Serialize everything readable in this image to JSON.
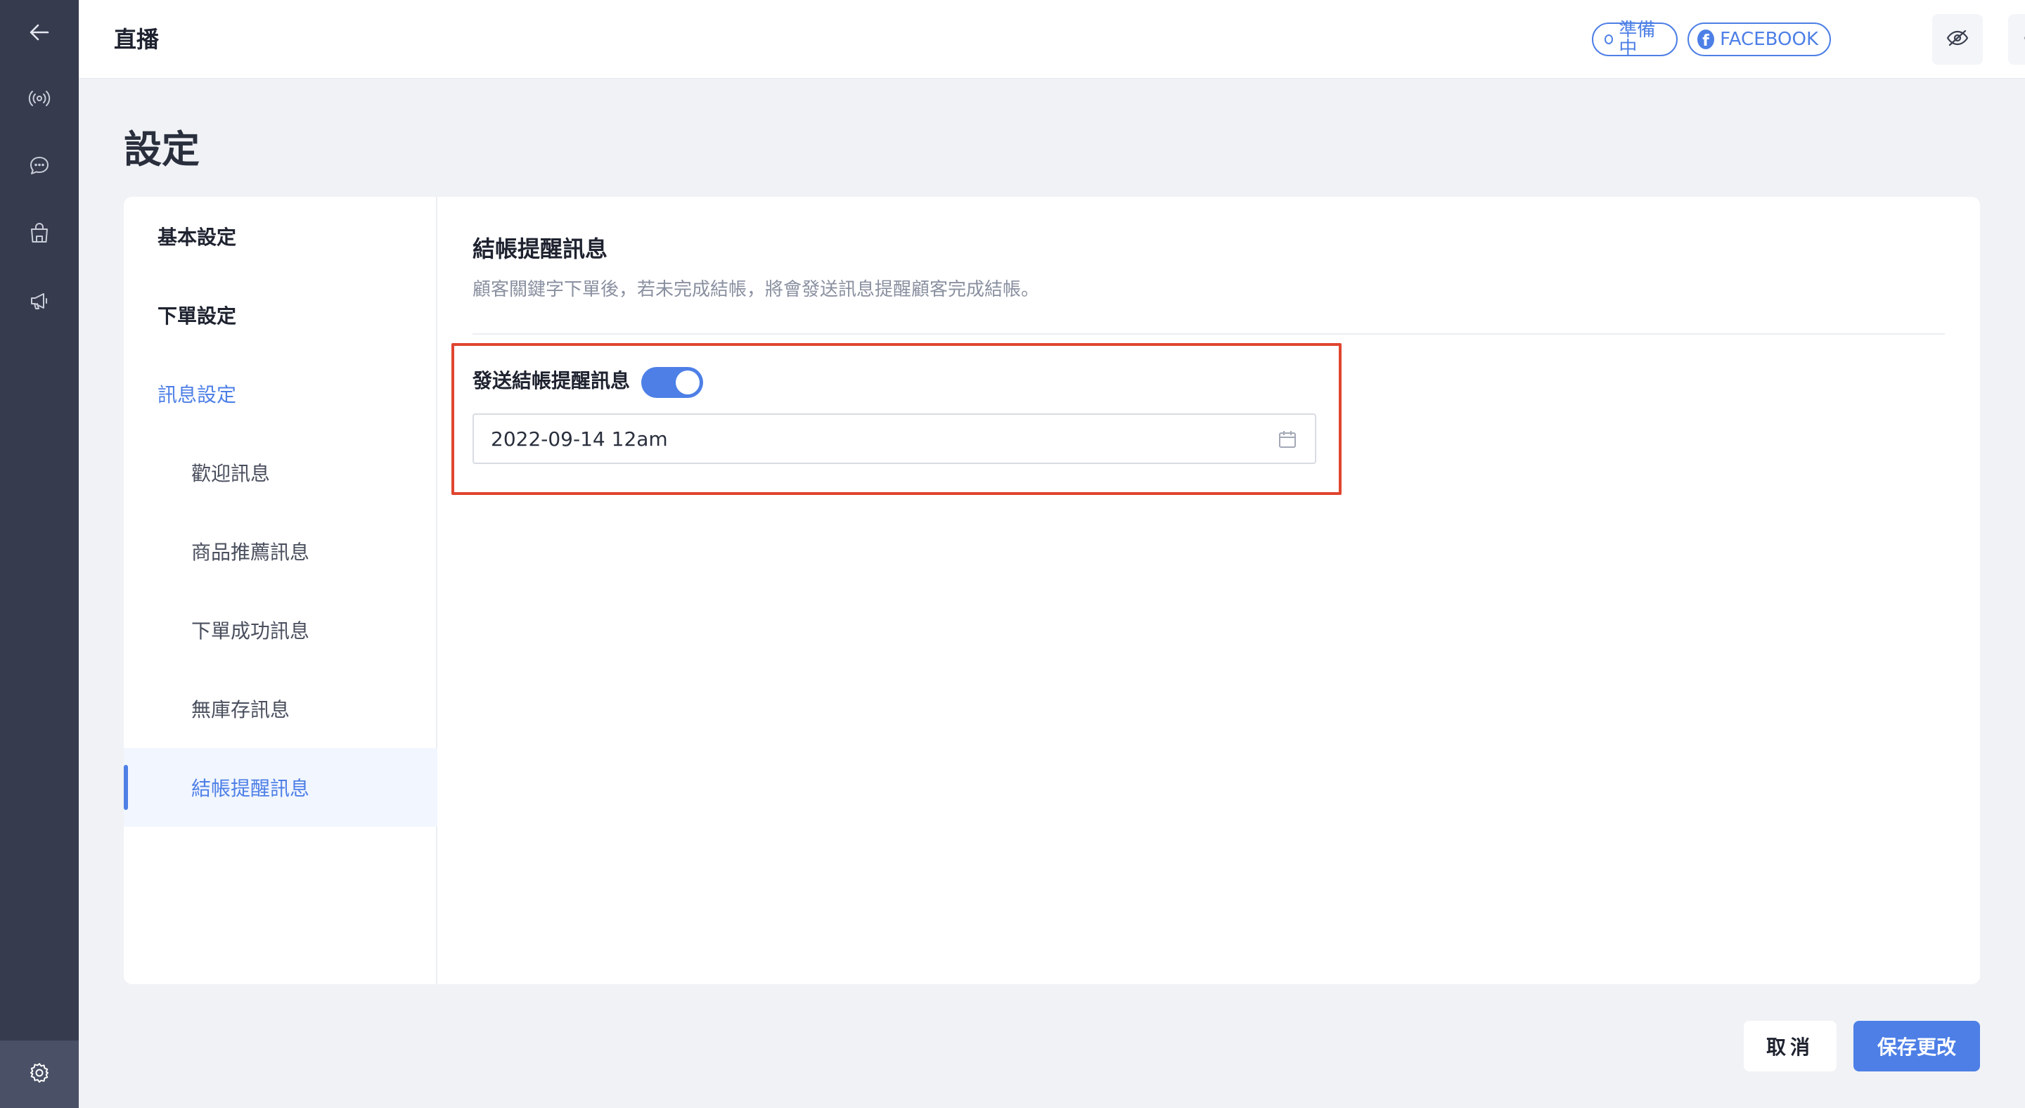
{
  "topbar": {
    "title": "直播",
    "status_label": "準備中",
    "platform_label": "FACEBOOK"
  },
  "page": {
    "title": "設定"
  },
  "sidebar": {
    "items": [
      {
        "label": "基本設定",
        "level": 1
      },
      {
        "label": "下單設定",
        "level": 1
      },
      {
        "label": "訊息設定",
        "level": 1,
        "expanded": true
      },
      {
        "label": "歡迎訊息",
        "level": 2
      },
      {
        "label": "商品推薦訊息",
        "level": 2
      },
      {
        "label": "下單成功訊息",
        "level": 2
      },
      {
        "label": "無庫存訊息",
        "level": 2
      },
      {
        "label": "結帳提醒訊息",
        "level": 2,
        "active": true
      }
    ]
  },
  "section": {
    "title": "結帳提醒訊息",
    "description": "顧客關鍵字下單後，若未完成結帳，將會發送訊息提醒顧客完成結帳。",
    "toggle_label": "發送結帳提醒訊息",
    "toggle_on": true,
    "date_value": "2022-09-14 12am"
  },
  "footer": {
    "cancel_label": "取消",
    "save_label": "保存更改"
  },
  "colors": {
    "accent": "#4d7fe6",
    "rail": "#363b4e",
    "highlight": "#e0452f"
  },
  "icons": [
    "back-arrow-icon",
    "broadcast-icon",
    "chat-icon",
    "shopping-bag-icon",
    "megaphone-icon",
    "gear-icon",
    "eye-off-icon",
    "share-icon",
    "facebook-icon",
    "calendar-icon"
  ]
}
